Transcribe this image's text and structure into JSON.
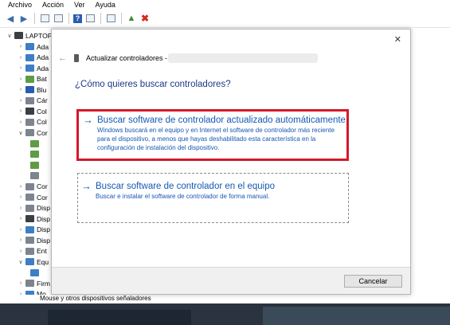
{
  "menu": [
    "Archivo",
    "Acción",
    "Ver",
    "Ayuda"
  ],
  "tree": {
    "root_label": "LAPTOP",
    "items": [
      {
        "label": "Ada",
        "icon": "monitor-icon",
        "color": "#3d7fc4"
      },
      {
        "label": "Ada",
        "icon": "display-adapter-icon",
        "color": "#3d7fc4"
      },
      {
        "label": "Ada",
        "icon": "display-adapter-icon",
        "color": "#3d7fc4"
      },
      {
        "label": "Bat",
        "icon": "battery-icon",
        "color": "#5f9c46"
      },
      {
        "label": "Blu",
        "icon": "bluetooth-icon",
        "color": "#2a5db0"
      },
      {
        "label": "Cár",
        "icon": "camera-icon",
        "color": "#7c858f"
      },
      {
        "label": "Col",
        "icon": "usb-controller-icon",
        "color": "#3b3f44"
      },
      {
        "label": "Col",
        "icon": "storage-controller-icon",
        "color": "#7c858f"
      },
      {
        "label": "Cor",
        "icon": "controller-icon",
        "color": "#7c858f"
      },
      {
        "label": "",
        "icon": "device-icon",
        "color": "#5f9c46"
      },
      {
        "label": "",
        "icon": "device-icon",
        "color": "#5f9c46"
      },
      {
        "label": "",
        "icon": "device-icon",
        "color": "#5f9c46"
      },
      {
        "label": "",
        "icon": "device-icon",
        "color": "#7c858f"
      },
      {
        "label": "Cor",
        "icon": "controller-icon",
        "color": "#7c858f"
      },
      {
        "label": "Cor",
        "icon": "audio-icon",
        "color": "#7c858f"
      },
      {
        "label": "Disp",
        "icon": "device-icon",
        "color": "#7c858f"
      },
      {
        "label": "Disp",
        "icon": "device-icon",
        "color": "#3b3f44"
      },
      {
        "label": "Disp",
        "icon": "device-icon",
        "color": "#3d7fc4"
      },
      {
        "label": "Disp",
        "icon": "device-icon",
        "color": "#7c858f"
      },
      {
        "label": "Ent",
        "icon": "input-icon",
        "color": "#7c858f"
      },
      {
        "label": "Equ",
        "icon": "computer-icon",
        "color": "#3d7fc4"
      },
      {
        "label": "",
        "icon": "computer-icon",
        "color": "#3d7fc4"
      },
      {
        "label": "Firm",
        "icon": "firmware-icon",
        "color": "#7c858f"
      },
      {
        "label": "Mo",
        "icon": "monitor-icon",
        "color": "#3d7fc4"
      }
    ],
    "status_label": "Mouse y otros dispositivos señaladores"
  },
  "dialog": {
    "title": "Actualizar controladores -",
    "question": "¿Cómo quieres buscar controladores?",
    "option1": {
      "title": "Buscar software de controlador actualizado automáticamente",
      "description": "Windows buscará en el equipo y en Internet el software de controlador más reciente para el dispositivo, a menos que hayas deshabilitado esta característica en la configuración de instalación del dispositivo."
    },
    "option2": {
      "title": "Buscar software de controlador en el equipo",
      "description": "Buscar e instalar el software de controlador de forma manual."
    },
    "cancel_label": "Cancelar"
  },
  "colors": {
    "link_blue": "#1558b3",
    "question_blue": "#1c3a8c",
    "highlight_red": "#d3192a"
  }
}
